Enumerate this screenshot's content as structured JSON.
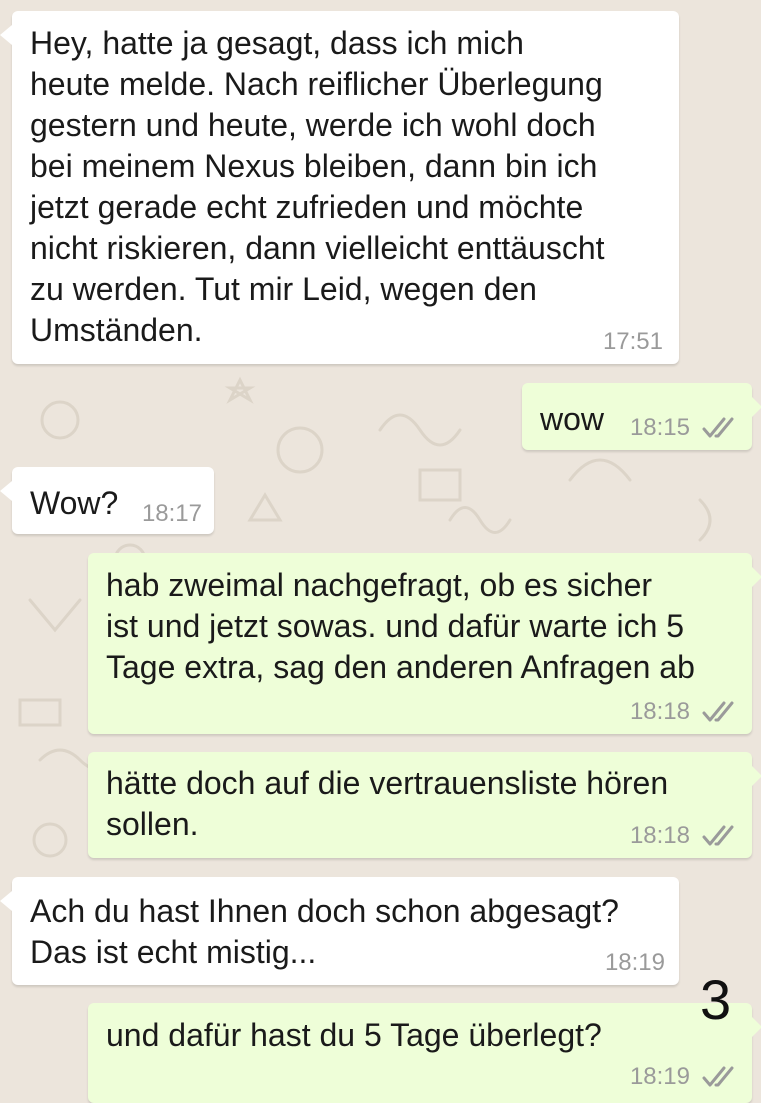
{
  "chat": {
    "messages": [
      {
        "direction": "in",
        "text": "Hey,  hatte ja gesagt,  dass ich mich\nheute melde. Nach reiflicher Überlegung\ngestern und heute, werde ich wohl doch\nbei meinem Nexus bleiben,  dann bin ich\njetzt gerade echt zufrieden und möchte\nnicht riskieren, dann vielleicht enttäuscht\nzu werden. Tut mir Leid,  wegen den\nUmständen.",
        "time": "17:51"
      },
      {
        "direction": "out",
        "text": "wow",
        "time": "18:15",
        "status": "read-double-check"
      },
      {
        "direction": "in",
        "text": "Wow?",
        "time": "18:17"
      },
      {
        "direction": "out",
        "text": "hab zweimal nachgefragt, ob es sicher\nist und jetzt sowas. und dafür warte ich 5\nTage extra, sag den anderen Anfragen ab",
        "time": "18:18",
        "status": "read-double-check"
      },
      {
        "direction": "out",
        "text": "hätte doch auf die vertrauensliste hören\nsollen.",
        "time": "18:18",
        "status": "read-double-check"
      },
      {
        "direction": "in",
        "text": "Ach du hast Ihnen doch schon abgesagt?\nDas ist echt mistig...",
        "time": "18:19"
      },
      {
        "direction": "out",
        "text": "und dafür hast du 5 Tage überlegt?",
        "time": "18:19",
        "status": "read-double-check"
      }
    ],
    "page_marker": "3"
  },
  "colors": {
    "background": "#ece5dc",
    "incoming_bubble": "#ffffff",
    "outgoing_bubble": "#eefed8",
    "timestamp": "#9a9a9a",
    "check_marks": "#9a9a9a"
  },
  "icons": {
    "read_receipt": "double-check-icon"
  }
}
